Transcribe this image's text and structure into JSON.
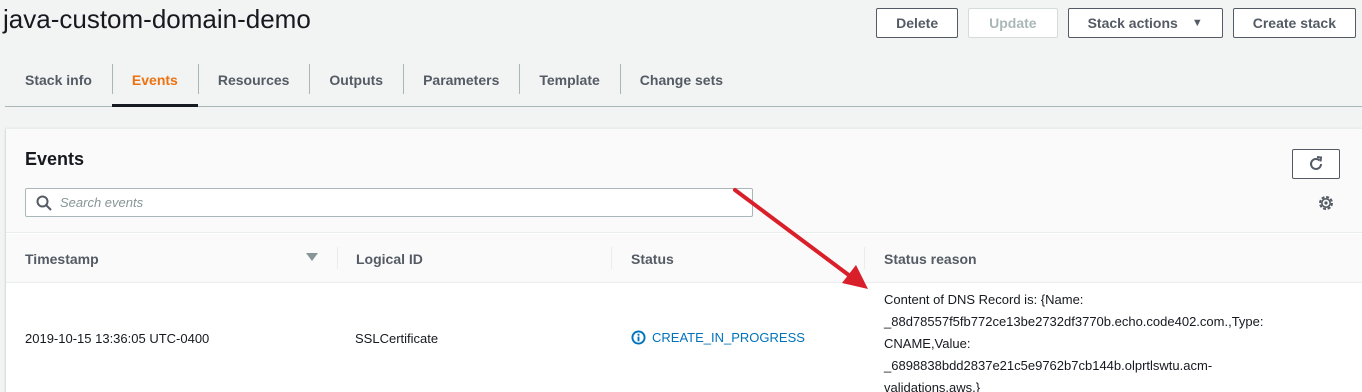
{
  "page": {
    "title": "java-custom-domain-demo"
  },
  "header_actions": {
    "delete": "Delete",
    "update": "Update",
    "stack_actions": "Stack actions",
    "create_stack": "Create stack"
  },
  "tabs": [
    {
      "label": "Stack info",
      "active": false
    },
    {
      "label": "Events",
      "active": true
    },
    {
      "label": "Resources",
      "active": false
    },
    {
      "label": "Outputs",
      "active": false
    },
    {
      "label": "Parameters",
      "active": false
    },
    {
      "label": "Template",
      "active": false
    },
    {
      "label": "Change sets",
      "active": false
    }
  ],
  "events_panel": {
    "title": "Events",
    "search_placeholder": "Search events",
    "columns": {
      "timestamp": "Timestamp",
      "logical_id": "Logical ID",
      "status": "Status",
      "status_reason": "Status reason"
    },
    "rows": [
      {
        "timestamp": "2019-10-15 13:36:05 UTC-0400",
        "logical_id": "SSLCertificate",
        "status": "CREATE_IN_PROGRESS",
        "status_reason_lines": [
          "Content of DNS Record is: {Name:",
          "_88d78557f5fb772ce13be2732df3770b.echo.code402.com.,Type:",
          "CNAME,Value:",
          "_6898838bdd2837e21c5e9762b7cb144b.olprtlswtu.acm-",
          "validations.aws.}"
        ]
      }
    ]
  },
  "colors": {
    "accent_tab": "#ec7211",
    "status_link": "#0073bb",
    "annotation_arrow": "#d9202a"
  },
  "icons": {
    "search": "search-icon",
    "refresh": "refresh-icon",
    "settings": "gear-icon",
    "info": "info-icon",
    "sort": "sort-down-icon"
  }
}
